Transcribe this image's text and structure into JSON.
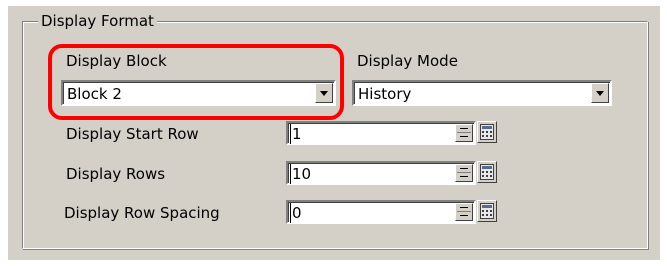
{
  "group": {
    "title": "Display Format"
  },
  "display_block": {
    "label": "Display Block",
    "value": "Block 2"
  },
  "display_mode": {
    "label": "Display Mode",
    "value": "History"
  },
  "start_row": {
    "label": "Display Start Row",
    "value": "1"
  },
  "rows": {
    "label": "Display Rows",
    "value": "10"
  },
  "row_spacing": {
    "label": "Display Row Spacing",
    "value": "0"
  },
  "colors": {
    "panel": "#d4d0c8",
    "highlight": "#ff0000"
  },
  "icons": [
    "chevron-down-icon",
    "spinner-icon",
    "calculator-icon"
  ]
}
